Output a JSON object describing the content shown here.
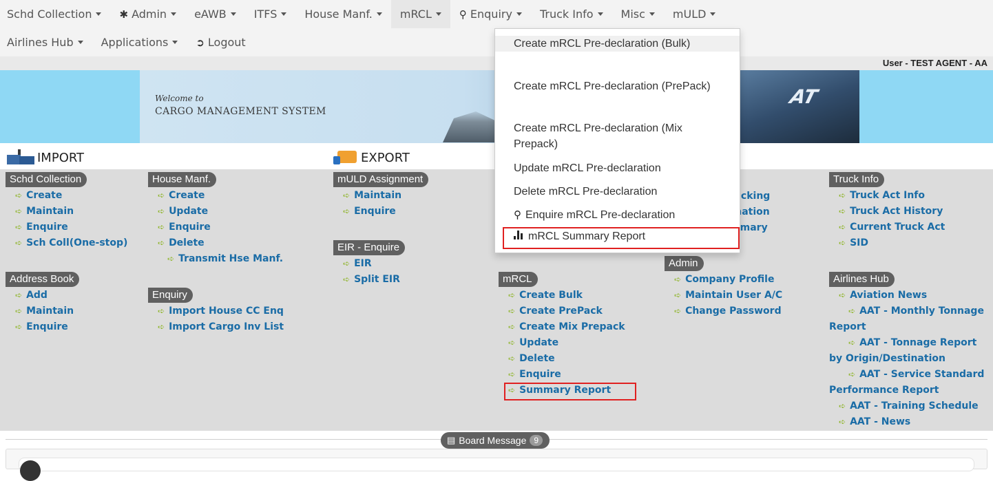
{
  "navbar": {
    "row1": [
      {
        "label": "Schd Collection",
        "caret": true
      },
      {
        "label": "Admin",
        "icon": "gear-icon",
        "caret": true
      },
      {
        "label": "eAWB",
        "caret": true
      },
      {
        "label": "ITFS",
        "caret": true
      },
      {
        "label": "House Manf.",
        "caret": true
      },
      {
        "label": "mRCL",
        "caret": true,
        "active": true
      },
      {
        "label": "Enquiry",
        "icon": "search-icon",
        "caret": true
      },
      {
        "label": "Truck Info",
        "caret": true
      },
      {
        "label": "Misc",
        "caret": true
      },
      {
        "label": "mULD",
        "caret": true
      }
    ],
    "row2": [
      {
        "label": "Airlines Hub",
        "caret": true
      },
      {
        "label": "Applications",
        "caret": true
      },
      {
        "label": "Logout",
        "icon": "logout-icon",
        "caret": false
      }
    ]
  },
  "user": {
    "text": "User - TEST AGENT - AA"
  },
  "banner": {
    "welcome_small": "Welcome to",
    "welcome_big": "CARGO MANAGEMENT SYSTEM",
    "logo_text": "AT"
  },
  "sections": {
    "import": "IMPORT",
    "export": "EXPORT"
  },
  "groups": {
    "schd_collection": {
      "title": "Schd Collection",
      "links": [
        "Create",
        "Maintain",
        "Enquire",
        "Sch Coll(One-stop)"
      ]
    },
    "address_book": {
      "title": "Address Book",
      "links": [
        "Add",
        "Maintain",
        "Enquire"
      ]
    },
    "house_manf": {
      "title": "House Manf.",
      "links": [
        "Create",
        "Update",
        "Enquire",
        "Delete",
        "Transmit Hse Manf."
      ]
    },
    "enquiry": {
      "title": "Enquiry",
      "links": [
        "Import House CC Enq",
        "Import Cargo Inv List"
      ]
    },
    "muld_assignment": {
      "title": "mULD Assignment",
      "links": [
        "Maintain",
        "Enquire"
      ]
    },
    "eir_enquire": {
      "title": "EIR - Enquire",
      "links": [
        "EIR",
        "Split EIR"
      ]
    },
    "mrcl": {
      "title": "mRCL",
      "links": [
        "Create Bulk",
        "Create PrePack",
        "Create Mix Prepack",
        "Update",
        "Delete",
        "Enquire",
        "Summary Report"
      ]
    },
    "partial": {
      "links": [
        "t Tracking",
        "formation",
        "Summary"
      ]
    },
    "admin": {
      "title": "Admin",
      "links": [
        "Company Profile",
        "Maintain User A/C",
        "Change Password"
      ]
    },
    "truck_info": {
      "title": "Truck Info",
      "links": [
        "Truck Act Info",
        "Truck Act History",
        "Current Truck Act",
        "SID"
      ]
    },
    "airlines_hub": {
      "title": "Airlines Hub",
      "links": [
        "Aviation News",
        "AAT - Monthly Tonnage Report",
        "AAT - Tonnage Report by Origin/Destination",
        "AAT - Service Standard Performance Report",
        "AAT - Training Schedule",
        "AAT - News"
      ]
    }
  },
  "dropdown": {
    "items": [
      {
        "label": "Create mRCL Pre-declaration (Bulk)"
      },
      {
        "label": "Create mRCL Pre-declaration (PrePack)"
      },
      {
        "label": "Create mRCL Pre-declaration (Mix Prepack)"
      },
      {
        "label": "Update mRCL Pre-declaration"
      },
      {
        "label": "Delete mRCL Pre-declaration"
      },
      {
        "label": "Enquire mRCL Pre-declaration",
        "icon": "search-icon"
      },
      {
        "label": "mRCL Summary Report",
        "icon": "bar-chart-icon"
      }
    ]
  },
  "board": {
    "label": "Board Message",
    "count": "9"
  },
  "colors": {
    "link": "#1a6ca6",
    "arrow": "#8fb52a",
    "pill": "#606060",
    "highlight": "#e02020",
    "main_bg": "#dcdcdc"
  }
}
